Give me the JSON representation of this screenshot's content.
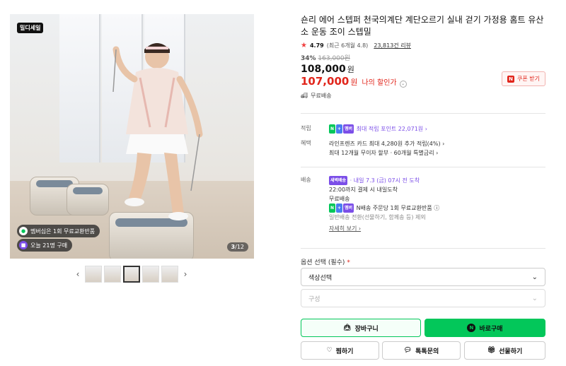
{
  "gallery": {
    "brand_badge": "밀디세일",
    "pill_membership": "멤버십은 1회 무료교환반품",
    "pill_today": "오늘 21명 구매",
    "counter_current": "3",
    "counter_total": "/12",
    "thumb_count": 5,
    "active_thumb": 3
  },
  "product": {
    "title": "숀리 에어 스텝퍼 천국의계단 계단오르기 실내 걷기 가정용 홈트 유산소 운동 조이 스텝밀",
    "rating": "4.79",
    "rating_recent": "(최근 6개월 4.8)",
    "reviews": "23,813건 리뷰",
    "discount_pct": "34%",
    "original_price": "163,000원",
    "price": "108,000",
    "price_unit": "원",
    "sale_price": "107,000",
    "sale_unit": "원",
    "sale_label": "나의 할인가",
    "coupon_label": "쿠폰 받기",
    "free_shipping": "무료배송"
  },
  "benefits": {
    "points_key": "적립",
    "points_tag1": "N",
    "points_tag2": "+",
    "points_tag3": "멤버",
    "points_text": "최대 적립 포인트 22,071원 ›",
    "benefit_key": "혜택",
    "benefit_line1": "라인프렌즈 카드 최대 4,280원 추가 적립(4%) ›",
    "benefit_line2": "최대 12개월 무이자 할부 · 60개월 특별금리 ›"
  },
  "delivery": {
    "key": "배송",
    "tag": "새벽배송",
    "express_text": " · 내일 7.3 (금) 07시 전 도착",
    "line2": "22:00까지 결제 시 내일도착",
    "line3": "무료배송",
    "return_tag1": "N",
    "return_tag2": "+",
    "return_tag3": "멤버",
    "return_text": "N배송 주문당 1회 무료교환반품 ⓘ",
    "note": "일반배송 전환(선물하기, 함께송 등) 제외",
    "details_link": "자세히 보기 ›"
  },
  "options": {
    "title": "옵션 선택 (필수)",
    "required_mark": "*",
    "select1": "색상선택",
    "select2": "구성"
  },
  "actions": {
    "cart": "장바구니",
    "buy": "바로구매",
    "wish": "찜하기",
    "talk": "톡톡문의",
    "gift": "선물하기"
  },
  "colors": {
    "accent_green": "#03c75a",
    "sale_red": "#e1251b",
    "membership_purple": "#7b4ee8"
  }
}
